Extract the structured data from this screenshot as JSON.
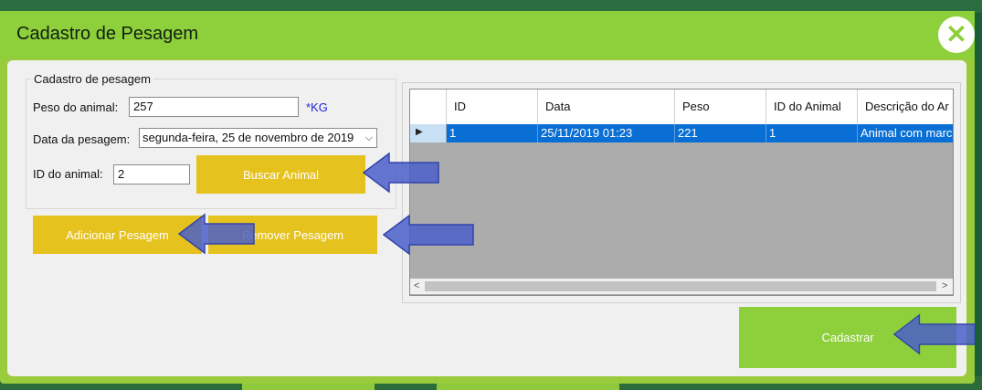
{
  "window": {
    "title": "Cadastro de Pesagem"
  },
  "form": {
    "group_title": "Cadastro de pesagem",
    "weight_label": "Peso do animal:",
    "weight_value": "257",
    "weight_unit": "*KG",
    "date_label": "Data da pesagem:",
    "date_value": "segunda-feira, 25 de novembro de 2019",
    "animal_id_label": "ID do animal:",
    "animal_id_value": "2"
  },
  "buttons": {
    "search": "Buscar Animal",
    "add": "Adicionar Pesagem",
    "remove": "Remover Pesagem",
    "register": "Cadastrar"
  },
  "grid": {
    "columns": [
      "ID",
      "Data",
      "Peso",
      "ID do Animal",
      "Descrição do Ar"
    ],
    "rows": [
      {
        "id": "1",
        "date": "25/11/2019 01:23",
        "weight": "221",
        "animal_id": "1",
        "description": "Animal com marc"
      }
    ]
  },
  "colors": {
    "accent_green": "#8ecf3c",
    "button_yellow": "#e6c21f",
    "selection_blue": "#0a6fd4",
    "arrow_blue": "#4a5fc8"
  },
  "icons": [
    "close-icon",
    "chevron-down-icon",
    "row-pointer-icon",
    "scroll-left-icon",
    "scroll-right-icon",
    "arrow-left-icon"
  ]
}
